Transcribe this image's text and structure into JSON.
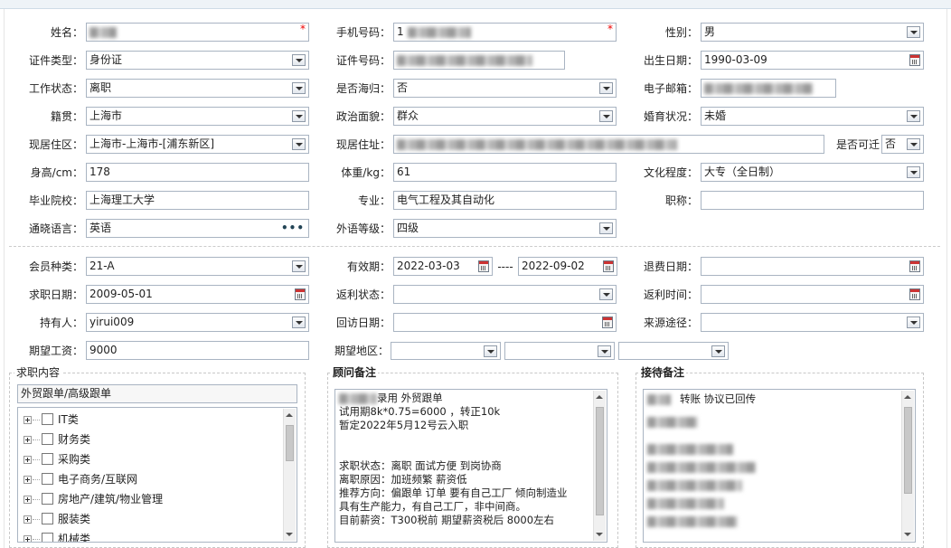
{
  "personal": {
    "name_label": "姓名：",
    "phone_label": "手机号码：",
    "phone_prefix": "1",
    "gender_label": "性别：",
    "gender_value": "男",
    "id_type_label": "证件类型：",
    "id_type_value": "身份证",
    "id_number_label": "证件号码：",
    "birth_label": "出生日期：",
    "birth_value": "1990-03-09",
    "work_status_label": "工作状态：",
    "work_status_value": "离职",
    "overseas_label": "是否海归：",
    "overseas_value": "否",
    "email_label": "电子邮箱：",
    "native_label": "籍贯：",
    "native_value": "上海市",
    "political_label": "政治面貌：",
    "political_value": "群众",
    "marital_label": "婚育状况：",
    "marital_value": "未婚",
    "residence_label": "现居住区：",
    "residence_value": "上海市-上海市-[浦东新区]",
    "address_label": "现居住址：",
    "relocate_label": "是否可迁",
    "relocate_value": "否",
    "height_label": "身高/cm：",
    "height_value": "178",
    "weight_label": "体重/kg：",
    "weight_value": "61",
    "education_label": "文化程度：",
    "education_value": "大专（全日制）",
    "school_label": "毕业院校：",
    "school_value": "上海理工大学",
    "major_label": "专业：",
    "major_value": "电气工程及其自动化",
    "title_label": "职称：",
    "title_value": "",
    "language_label": "通晓语言：",
    "language_value": "英语",
    "language_more": "•••",
    "lang_level_label": "外语等级：",
    "lang_level_value": "四级",
    "required_mark": "*"
  },
  "membership": {
    "member_type_label": "会员种类：",
    "member_type_value": "21-A",
    "validity_label": "有效期：",
    "validity_start": "2022-03-03",
    "validity_dash": "----",
    "validity_end": "2022-09-02",
    "refund_date_label": "退费日期：",
    "refund_date_value": "",
    "job_date_label": "求职日期：",
    "job_date_value": "2009-05-01",
    "rebate_status_label": "返利状态：",
    "rebate_status_value": "",
    "rebate_time_label": "返利时间：",
    "rebate_time_value": "",
    "holder_label": "持有人：",
    "holder_value": "yirui009",
    "visit_date_label": "回访日期：",
    "visit_date_value": "",
    "source_label": "来源途径：",
    "source_value": "",
    "salary_label": "期望工资：",
    "salary_value": "9000",
    "region_label": "期望地区："
  },
  "job_content": {
    "title": "求职内容",
    "selected": "外贸跟单/高级跟单",
    "categories": [
      "IT类",
      "财务类",
      "采购类",
      "电子商务/互联网",
      "房地产/建筑/物业管理",
      "服装类",
      "机械类"
    ]
  },
  "advisor_notes": {
    "title": "顾问备注",
    "lines": [
      "录用  外贸跟单",
      "试用期8k*0.75=6000 ，转正10k",
      "暂定2022年5月12号云入职",
      "",
      "",
      "求职状态：离职  面试方便 到岗协商",
      "离职原因：加班频繁  薪资低",
      "推荐方向：偏跟单 订单 要有自己工厂 倾向制造业",
      "具有生产能力，有自己工厂，非中间商。",
      "目前薪资：T300税前  期望薪资税后 8000左右"
    ]
  },
  "reception_notes": {
    "title": "接待备注",
    "first_line": "转账 协议已回传"
  }
}
